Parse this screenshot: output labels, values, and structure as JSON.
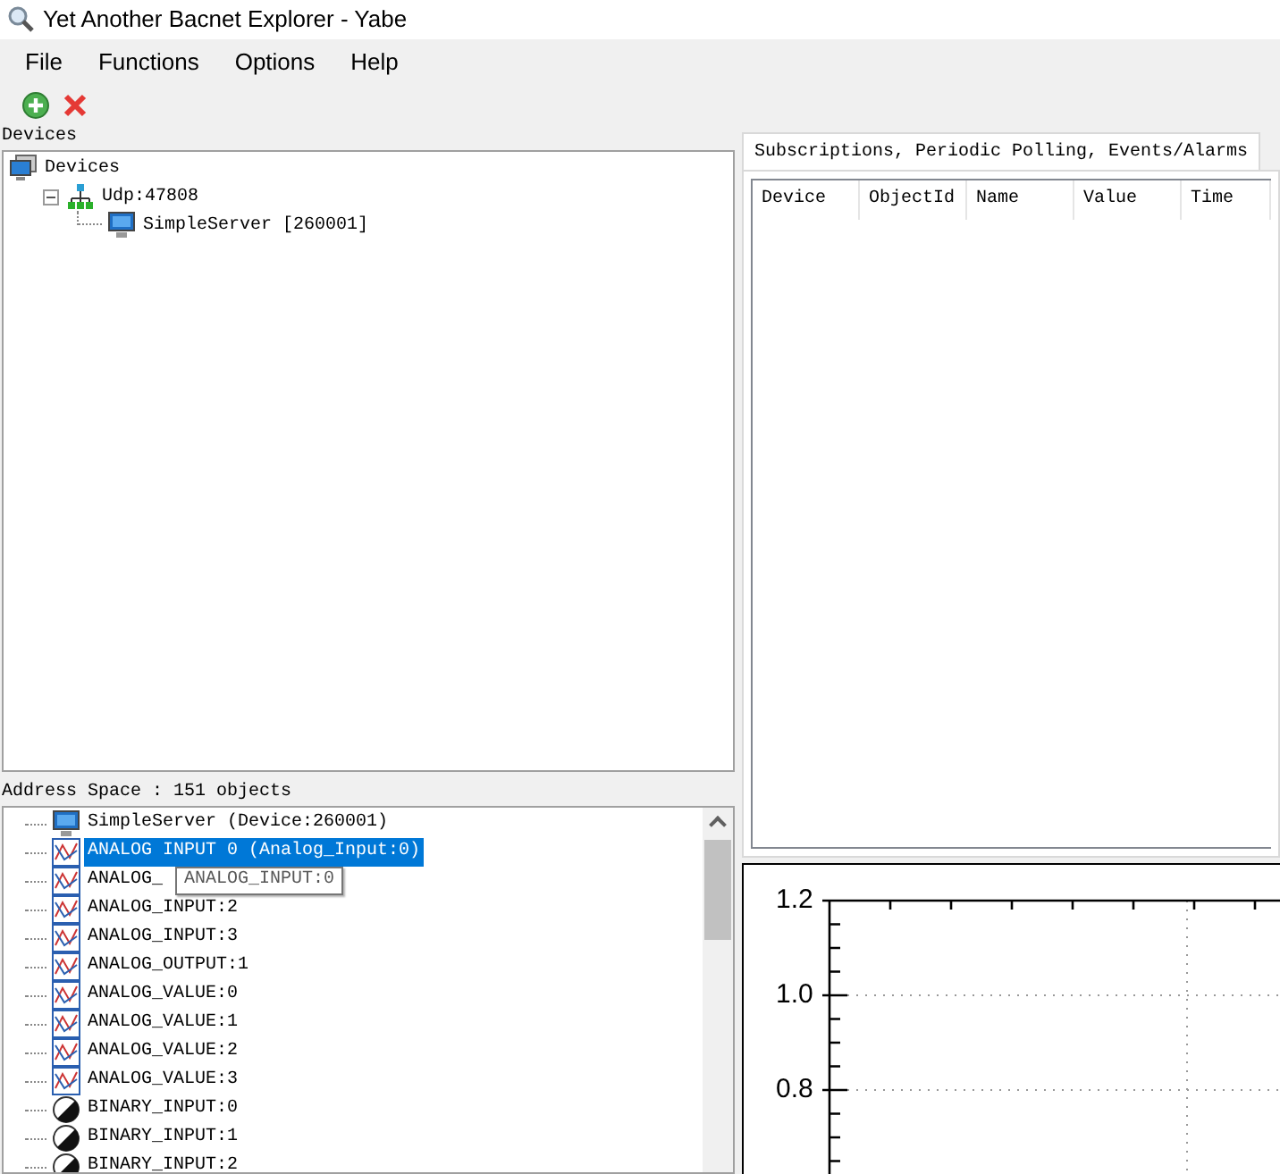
{
  "window": {
    "title": "Yet Another Bacnet Explorer - Yabe"
  },
  "menu": [
    "File",
    "Functions",
    "Options",
    "Help"
  ],
  "toolbar": [
    {
      "kind": "add"
    },
    {
      "kind": "remove"
    }
  ],
  "devices": {
    "label": "Devices",
    "tree": [
      {
        "label": "Devices",
        "kind": "root",
        "children": [
          {
            "label": "Udp:47808",
            "kind": "network",
            "expanded": true,
            "children": [
              {
                "label": "SimpleServer [260001]",
                "kind": "device"
              }
            ]
          }
        ]
      }
    ]
  },
  "address_space": {
    "label": "Address Space : 151 objects",
    "items": [
      {
        "label": "SimpleServer (Device:260001)",
        "kind": "device",
        "selected": false
      },
      {
        "label": "ANALOG INPUT 0 (Analog_Input:0)",
        "kind": "analog",
        "selected": true
      },
      {
        "label": "ANALOG_",
        "kind": "analog",
        "selected": false
      },
      {
        "label": "ANALOG_INPUT:2",
        "kind": "analog",
        "selected": false
      },
      {
        "label": "ANALOG_INPUT:3",
        "kind": "analog",
        "selected": false
      },
      {
        "label": "ANALOG_OUTPUT:1",
        "kind": "analog",
        "selected": false
      },
      {
        "label": "ANALOG_VALUE:0",
        "kind": "analog",
        "selected": false
      },
      {
        "label": "ANALOG_VALUE:1",
        "kind": "analog",
        "selected": false
      },
      {
        "label": "ANALOG_VALUE:2",
        "kind": "analog",
        "selected": false
      },
      {
        "label": "ANALOG_VALUE:3",
        "kind": "analog",
        "selected": false
      },
      {
        "label": "BINARY_INPUT:0",
        "kind": "binary",
        "selected": false
      },
      {
        "label": "BINARY_INPUT:1",
        "kind": "binary",
        "selected": false
      },
      {
        "label": "BINARY_INPUT:2",
        "kind": "binary",
        "selected": false
      }
    ],
    "tooltip": "ANALOG_INPUT:0"
  },
  "tabs": [
    {
      "label": "Subscriptions, Periodic Polling, Events/Alarms",
      "selected": true
    }
  ],
  "table": {
    "columns": [
      "Device",
      "ObjectId",
      "Name",
      "Value",
      "Time"
    ]
  },
  "chart": {
    "y_labels": [
      "1.2",
      "1.0",
      "0.8"
    ]
  }
}
